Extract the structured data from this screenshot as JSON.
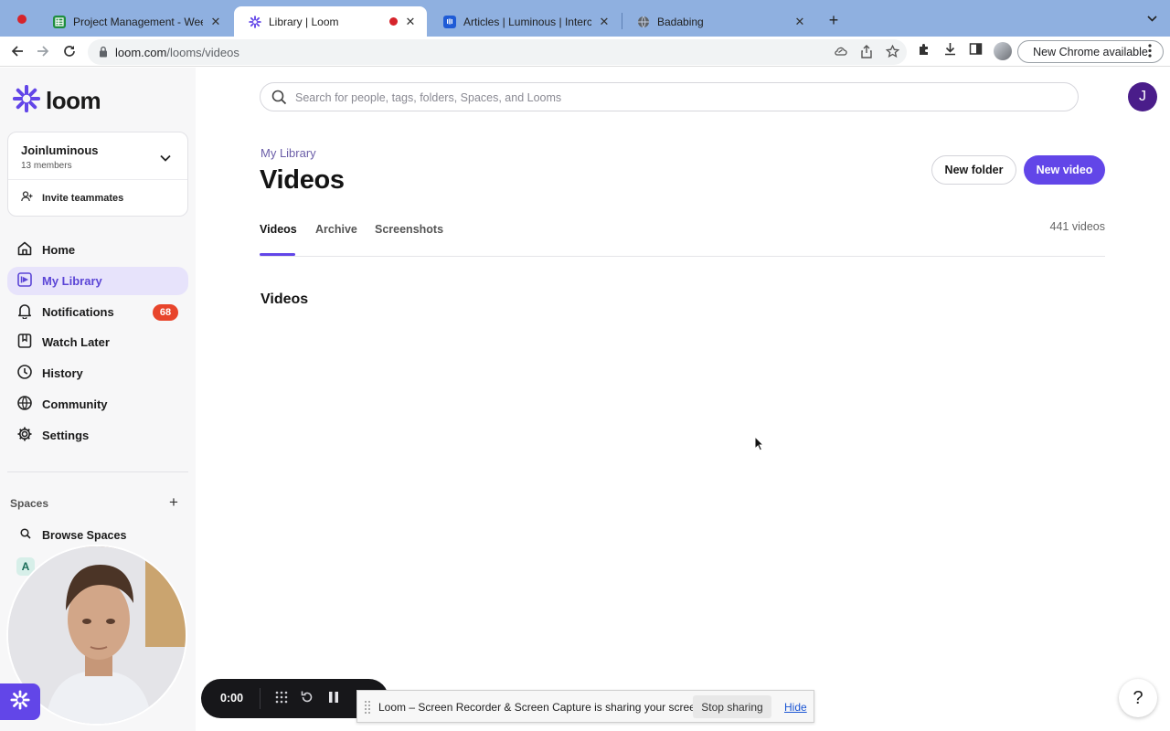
{
  "browser": {
    "tabs": [
      {
        "title": "Project Management - Weekly",
        "favicon": "google-sheets-icon"
      },
      {
        "title": "Library | Loom",
        "favicon": "loom-icon"
      },
      {
        "title": "Articles | Luminous | Intercom",
        "favicon": "intercom-icon"
      },
      {
        "title": "Badabing",
        "favicon": "globe-icon"
      }
    ],
    "url_host": "loom.com",
    "url_path": "/looms/videos",
    "update_label": "New Chrome available"
  },
  "sidebar": {
    "brand": "loom",
    "workspace": {
      "name": "Joinluminous",
      "members": "13 members"
    },
    "invite_label": "Invite teammates",
    "nav": [
      {
        "label": "Home",
        "icon": "home-icon"
      },
      {
        "label": "My Library",
        "icon": "library-icon"
      },
      {
        "label": "Notifications",
        "icon": "bell-icon",
        "badge": "68"
      },
      {
        "label": "Watch Later",
        "icon": "bookmark-icon"
      },
      {
        "label": "History",
        "icon": "clock-icon"
      },
      {
        "label": "Community",
        "icon": "globe-icon"
      },
      {
        "label": "Settings",
        "icon": "gear-icon"
      }
    ],
    "spaces_label": "Spaces",
    "browse_spaces_label": "Browse Spaces",
    "space_initial": "A"
  },
  "main": {
    "search_placeholder": "Search for people, tags, folders, Spaces, and Looms",
    "user_initial": "J",
    "breadcrumb": "My Library",
    "title": "Videos",
    "new_folder_label": "New folder",
    "new_video_label": "New video",
    "tabs": [
      {
        "label": "Videos"
      },
      {
        "label": "Archive"
      },
      {
        "label": "Screenshots"
      }
    ],
    "video_count": "441 videos",
    "section_title": "Videos"
  },
  "recorder": {
    "time": "0:00"
  },
  "share_bar": {
    "message": "Loom – Screen Recorder & Screen Capture is sharing your screen.",
    "stop_label": "Stop sharing",
    "hide_label": "Hide"
  },
  "help_label": "?",
  "colors": {
    "accent": "#6246e8",
    "badge": "#e8452c",
    "active_nav_bg": "#e7e3fb"
  }
}
